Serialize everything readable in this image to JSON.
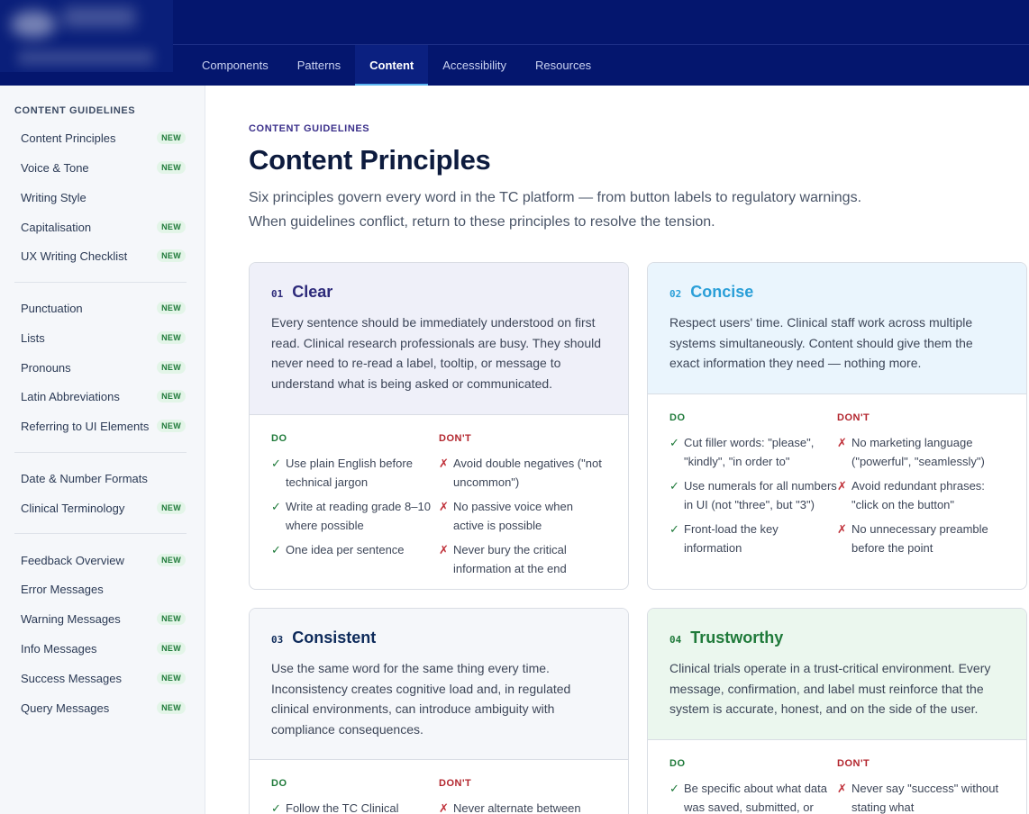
{
  "nav": {
    "tabs": [
      {
        "label": "Components"
      },
      {
        "label": "Patterns"
      },
      {
        "label": "Content"
      },
      {
        "label": "Accessibility"
      },
      {
        "label": "Resources"
      }
    ],
    "active": "Content"
  },
  "sidebar": {
    "heading": "CONTENT GUIDELINES",
    "badge_label": "NEW",
    "items": [
      {
        "label": "Content Principles",
        "badge": "NEW"
      },
      {
        "label": "Voice & Tone",
        "badge": "NEW"
      },
      {
        "label": "Writing Style",
        "badge": ""
      },
      {
        "label": "Capitalisation",
        "badge": "NEW"
      },
      {
        "label": "UX Writing Checklist",
        "badge": "NEW"
      },
      {
        "label": "Punctuation",
        "badge": "NEW"
      },
      {
        "label": "Lists",
        "badge": "NEW"
      },
      {
        "label": "Pronouns",
        "badge": "NEW"
      },
      {
        "label": "Latin Abbreviations",
        "badge": "NEW"
      },
      {
        "label": "Referring to UI Elements",
        "badge": "NEW"
      },
      {
        "label": "Date & Number Formats",
        "badge": ""
      },
      {
        "label": "Clinical Terminology",
        "badge": "NEW"
      },
      {
        "label": "Feedback Overview",
        "badge": "NEW"
      },
      {
        "label": "Error Messages",
        "badge": ""
      },
      {
        "label": "Warning Messages",
        "badge": "NEW"
      },
      {
        "label": "Info Messages",
        "badge": "NEW"
      },
      {
        "label": "Success Messages",
        "badge": "NEW"
      },
      {
        "label": "Query Messages",
        "badge": "NEW"
      }
    ]
  },
  "main": {
    "kicker": "CONTENT GUIDELINES",
    "title": "Content Principles",
    "intro_line1": "Six principles govern every word in the TC platform — from button labels to regulatory warnings.",
    "intro_line2": "When guidelines conflict, return to these principles to resolve the tension."
  },
  "labels": {
    "do": "DO",
    "dont": "DON'T"
  },
  "cards": [
    {
      "num": "01",
      "title": "Clear",
      "color": "#2d2a7a",
      "desc": "Every sentence should be immediately understood on first read. Clinical research professionals are busy. They should never need to re-read a label, tooltip, or message to understand what is being asked or communicated.",
      "do": [
        "Use plain English before technical jargon",
        "Write at reading grade 8–10 where possible",
        "One idea per sentence"
      ],
      "dont": [
        "Avoid double negatives (\"not uncommon\")",
        "No passive voice when active is possible",
        "Never bury the critical information at the end"
      ]
    },
    {
      "num": "02",
      "title": "Concise",
      "color": "#2a9fd8",
      "desc": "Respect users' time. Clinical staff work across multiple systems simultaneously. Content should give them the exact information they need — nothing more.",
      "do": [
        "Cut filler words: \"please\", \"kindly\", \"in order to\"",
        "Use numerals for all numbers in UI (not \"three\", but \"3\")",
        "Front-load the key information"
      ],
      "dont": [
        "No marketing language (\"powerful\", \"seamlessly\")",
        "Avoid redundant phrases: \"click on the button\"",
        "No unnecessary preamble before the point"
      ]
    },
    {
      "num": "03",
      "title": "Consistent",
      "color": "#0d2a5a",
      "desc": "Use the same word for the same thing every time. Inconsistency creates cognitive load and, in regulated clinical environments, can introduce ambiguity with compliance consequences.",
      "do": [
        "Follow the TC Clinical"
      ],
      "dont": [
        "Never alternate between"
      ]
    },
    {
      "num": "04",
      "title": "Trustworthy",
      "color": "#1f7a3a",
      "desc": "Clinical trials operate in a trust-critical environment. Every message, confirmation, and label must reinforce that the system is accurate, honest, and on the side of the user.",
      "do": [
        "Be specific about what data was saved, submitted, or"
      ],
      "dont": [
        "Never say \"success\" without stating what"
      ]
    }
  ]
}
